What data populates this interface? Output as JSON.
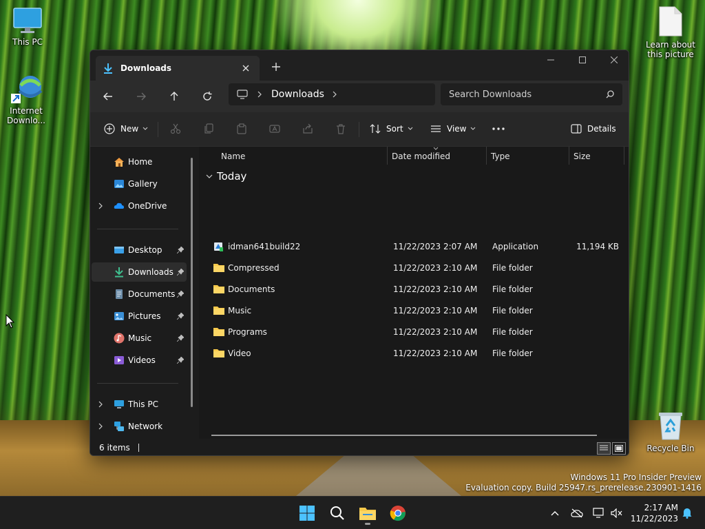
{
  "desktop": {
    "icons": [
      {
        "label": "This PC"
      },
      {
        "label": "Internet Downlo..."
      },
      {
        "label": "Learn about this picture"
      },
      {
        "label": "Recycle Bin"
      }
    ],
    "watermark": {
      "line1": "Windows 11 Pro Insider Preview",
      "line2": "Evaluation copy. Build 25947.rs_prerelease.230901-1416"
    }
  },
  "window": {
    "tab": {
      "title": "Downloads"
    },
    "address": {
      "crumb": "Downloads"
    },
    "search": {
      "placeholder": "Search Downloads"
    },
    "commands": {
      "new": "New",
      "sort": "Sort",
      "view": "View",
      "details": "Details"
    },
    "nav": {
      "items": [
        {
          "label": "Home"
        },
        {
          "label": "Gallery"
        },
        {
          "label": "OneDrive"
        },
        {
          "label": "Desktop"
        },
        {
          "label": "Downloads"
        },
        {
          "label": "Documents"
        },
        {
          "label": "Pictures"
        },
        {
          "label": "Music"
        },
        {
          "label": "Videos"
        },
        {
          "label": "This PC"
        },
        {
          "label": "Network"
        }
      ]
    },
    "columns": {
      "name": "Name",
      "date": "Date modified",
      "type": "Type",
      "size": "Size"
    },
    "group": "Today",
    "files": [
      {
        "name": "idman641build22",
        "date": "11/22/2023 2:07 AM",
        "type": "Application",
        "size": "11,194 KB"
      },
      {
        "name": "Compressed",
        "date": "11/22/2023 2:10 AM",
        "type": "File folder",
        "size": ""
      },
      {
        "name": "Documents",
        "date": "11/22/2023 2:10 AM",
        "type": "File folder",
        "size": ""
      },
      {
        "name": "Music",
        "date": "11/22/2023 2:10 AM",
        "type": "File folder",
        "size": ""
      },
      {
        "name": "Programs",
        "date": "11/22/2023 2:10 AM",
        "type": "File folder",
        "size": ""
      },
      {
        "name": "Video",
        "date": "11/22/2023 2:10 AM",
        "type": "File folder",
        "size": ""
      }
    ],
    "status": {
      "items": "6 items"
    }
  },
  "taskbar": {
    "time": "2:17 AM",
    "date": "11/22/2023"
  },
  "colors": {
    "accent": "#4cc2ff",
    "folder": "#f8c94b",
    "window_bg": "#1c1c1c",
    "taskbar_bg": "#1f1f1f"
  }
}
